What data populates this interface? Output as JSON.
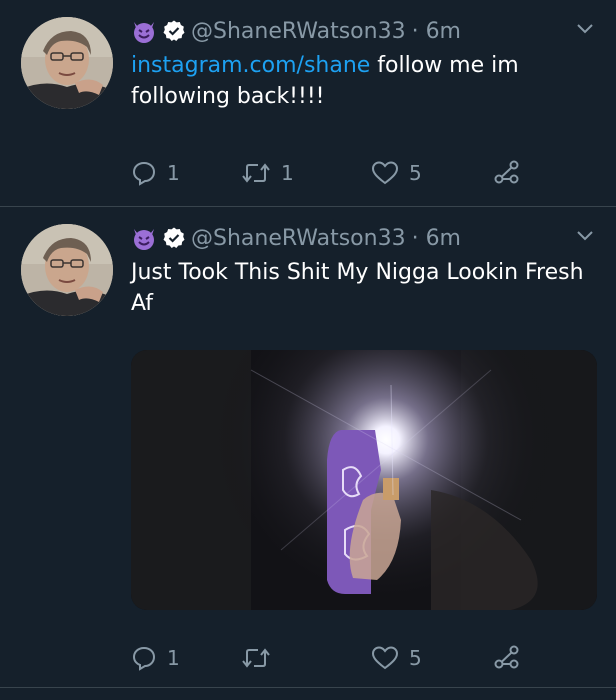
{
  "tweets": [
    {
      "handle": "@ShaneRWatson33",
      "time": "· 6m",
      "text_link": "instagram.com/shane",
      "text_rest": " follow me im following back!!!!",
      "reply_count": "1",
      "retweet_count": "1",
      "like_count": "5"
    },
    {
      "handle": "@ShaneRWatson33",
      "time": "· 6m",
      "text": "Just Took This Shit My Nigga Lookin Fresh Af",
      "reply_count": "1",
      "retweet_count": "",
      "like_count": "5"
    }
  ],
  "icons": {
    "header": [
      "smiling-devil-emoji-icon",
      "verified-badge-icon"
    ],
    "menu": "chevron-down-icon",
    "actions": [
      "reply-icon",
      "retweet-icon",
      "like-icon",
      "share-icon"
    ]
  },
  "colors": {
    "background": "#15202b",
    "text": "#ffffff",
    "muted": "#8899a6",
    "link": "#1da1f2",
    "emoji_purple": "#9b6fd6"
  }
}
